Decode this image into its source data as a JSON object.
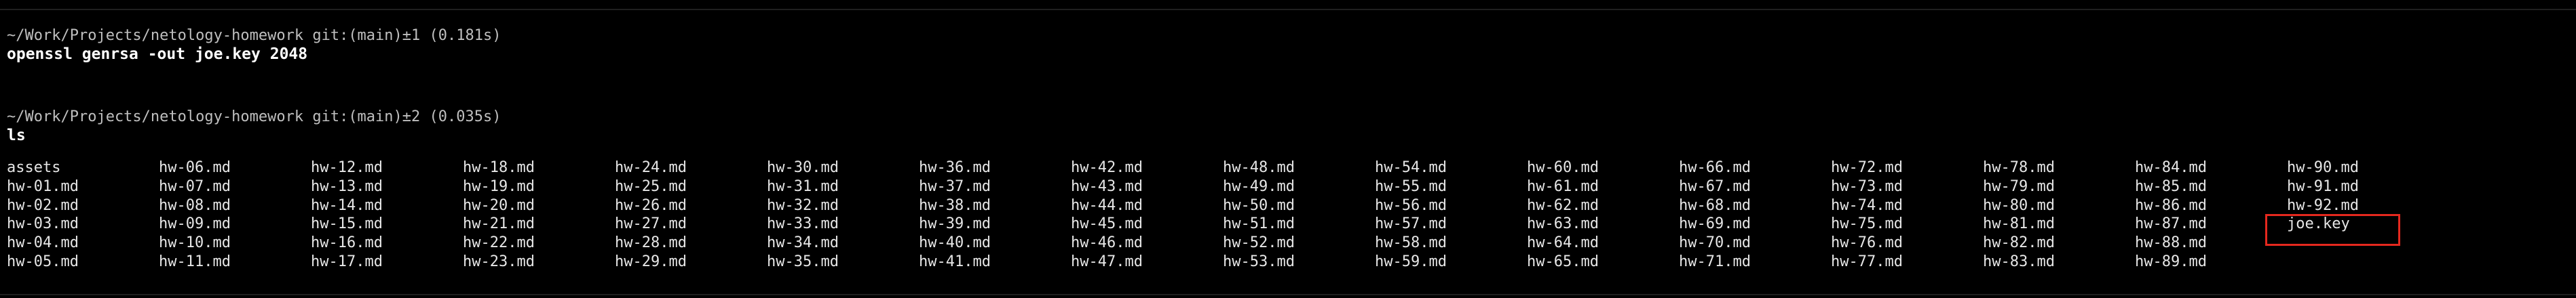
{
  "blocks": [
    {
      "prompt": "~/Work/Projects/netology-homework git:(main)±1 (0.181s)",
      "command": "openssl genrsa -out joe.key 2048"
    },
    {
      "prompt": "~/Work/Projects/netology-homework git:(main)±2 (0.035s)",
      "command": "ls"
    }
  ],
  "listing": [
    "assets",
    "hw-01.md",
    "hw-02.md",
    "hw-03.md",
    "hw-04.md",
    "hw-05.md",
    "hw-06.md",
    "hw-07.md",
    "hw-08.md",
    "hw-09.md",
    "hw-10.md",
    "hw-11.md",
    "hw-12.md",
    "hw-13.md",
    "hw-14.md",
    "hw-15.md",
    "hw-16.md",
    "hw-17.md",
    "hw-18.md",
    "hw-19.md",
    "hw-20.md",
    "hw-21.md",
    "hw-22.md",
    "hw-23.md",
    "hw-24.md",
    "hw-25.md",
    "hw-26.md",
    "hw-27.md",
    "hw-28.md",
    "hw-29.md",
    "hw-30.md",
    "hw-31.md",
    "hw-32.md",
    "hw-33.md",
    "hw-34.md",
    "hw-35.md",
    "hw-36.md",
    "hw-37.md",
    "hw-38.md",
    "hw-39.md",
    "hw-40.md",
    "hw-41.md",
    "hw-42.md",
    "hw-43.md",
    "hw-44.md",
    "hw-45.md",
    "hw-46.md",
    "hw-47.md",
    "hw-48.md",
    "hw-49.md",
    "hw-50.md",
    "hw-51.md",
    "hw-52.md",
    "hw-53.md",
    "hw-54.md",
    "hw-55.md",
    "hw-56.md",
    "hw-57.md",
    "hw-58.md",
    "hw-59.md",
    "hw-60.md",
    "hw-61.md",
    "hw-62.md",
    "hw-63.md",
    "hw-64.md",
    "hw-65.md",
    "hw-66.md",
    "hw-67.md",
    "hw-68.md",
    "hw-69.md",
    "hw-70.md",
    "hw-71.md",
    "hw-72.md",
    "hw-73.md",
    "hw-74.md",
    "hw-75.md",
    "hw-76.md",
    "hw-77.md",
    "hw-78.md",
    "hw-79.md",
    "hw-80.md",
    "hw-81.md",
    "hw-82.md",
    "hw-83.md",
    "hw-84.md",
    "hw-85.md",
    "hw-86.md",
    "hw-87.md",
    "hw-88.md",
    "hw-89.md",
    "hw-90.md",
    "hw-91.md",
    "hw-92.md",
    "joe.key"
  ],
  "highlighted_file": "joe.key",
  "colors": {
    "background": "#000000",
    "text": "#e6e6e6",
    "highlight": "#e5281e"
  }
}
